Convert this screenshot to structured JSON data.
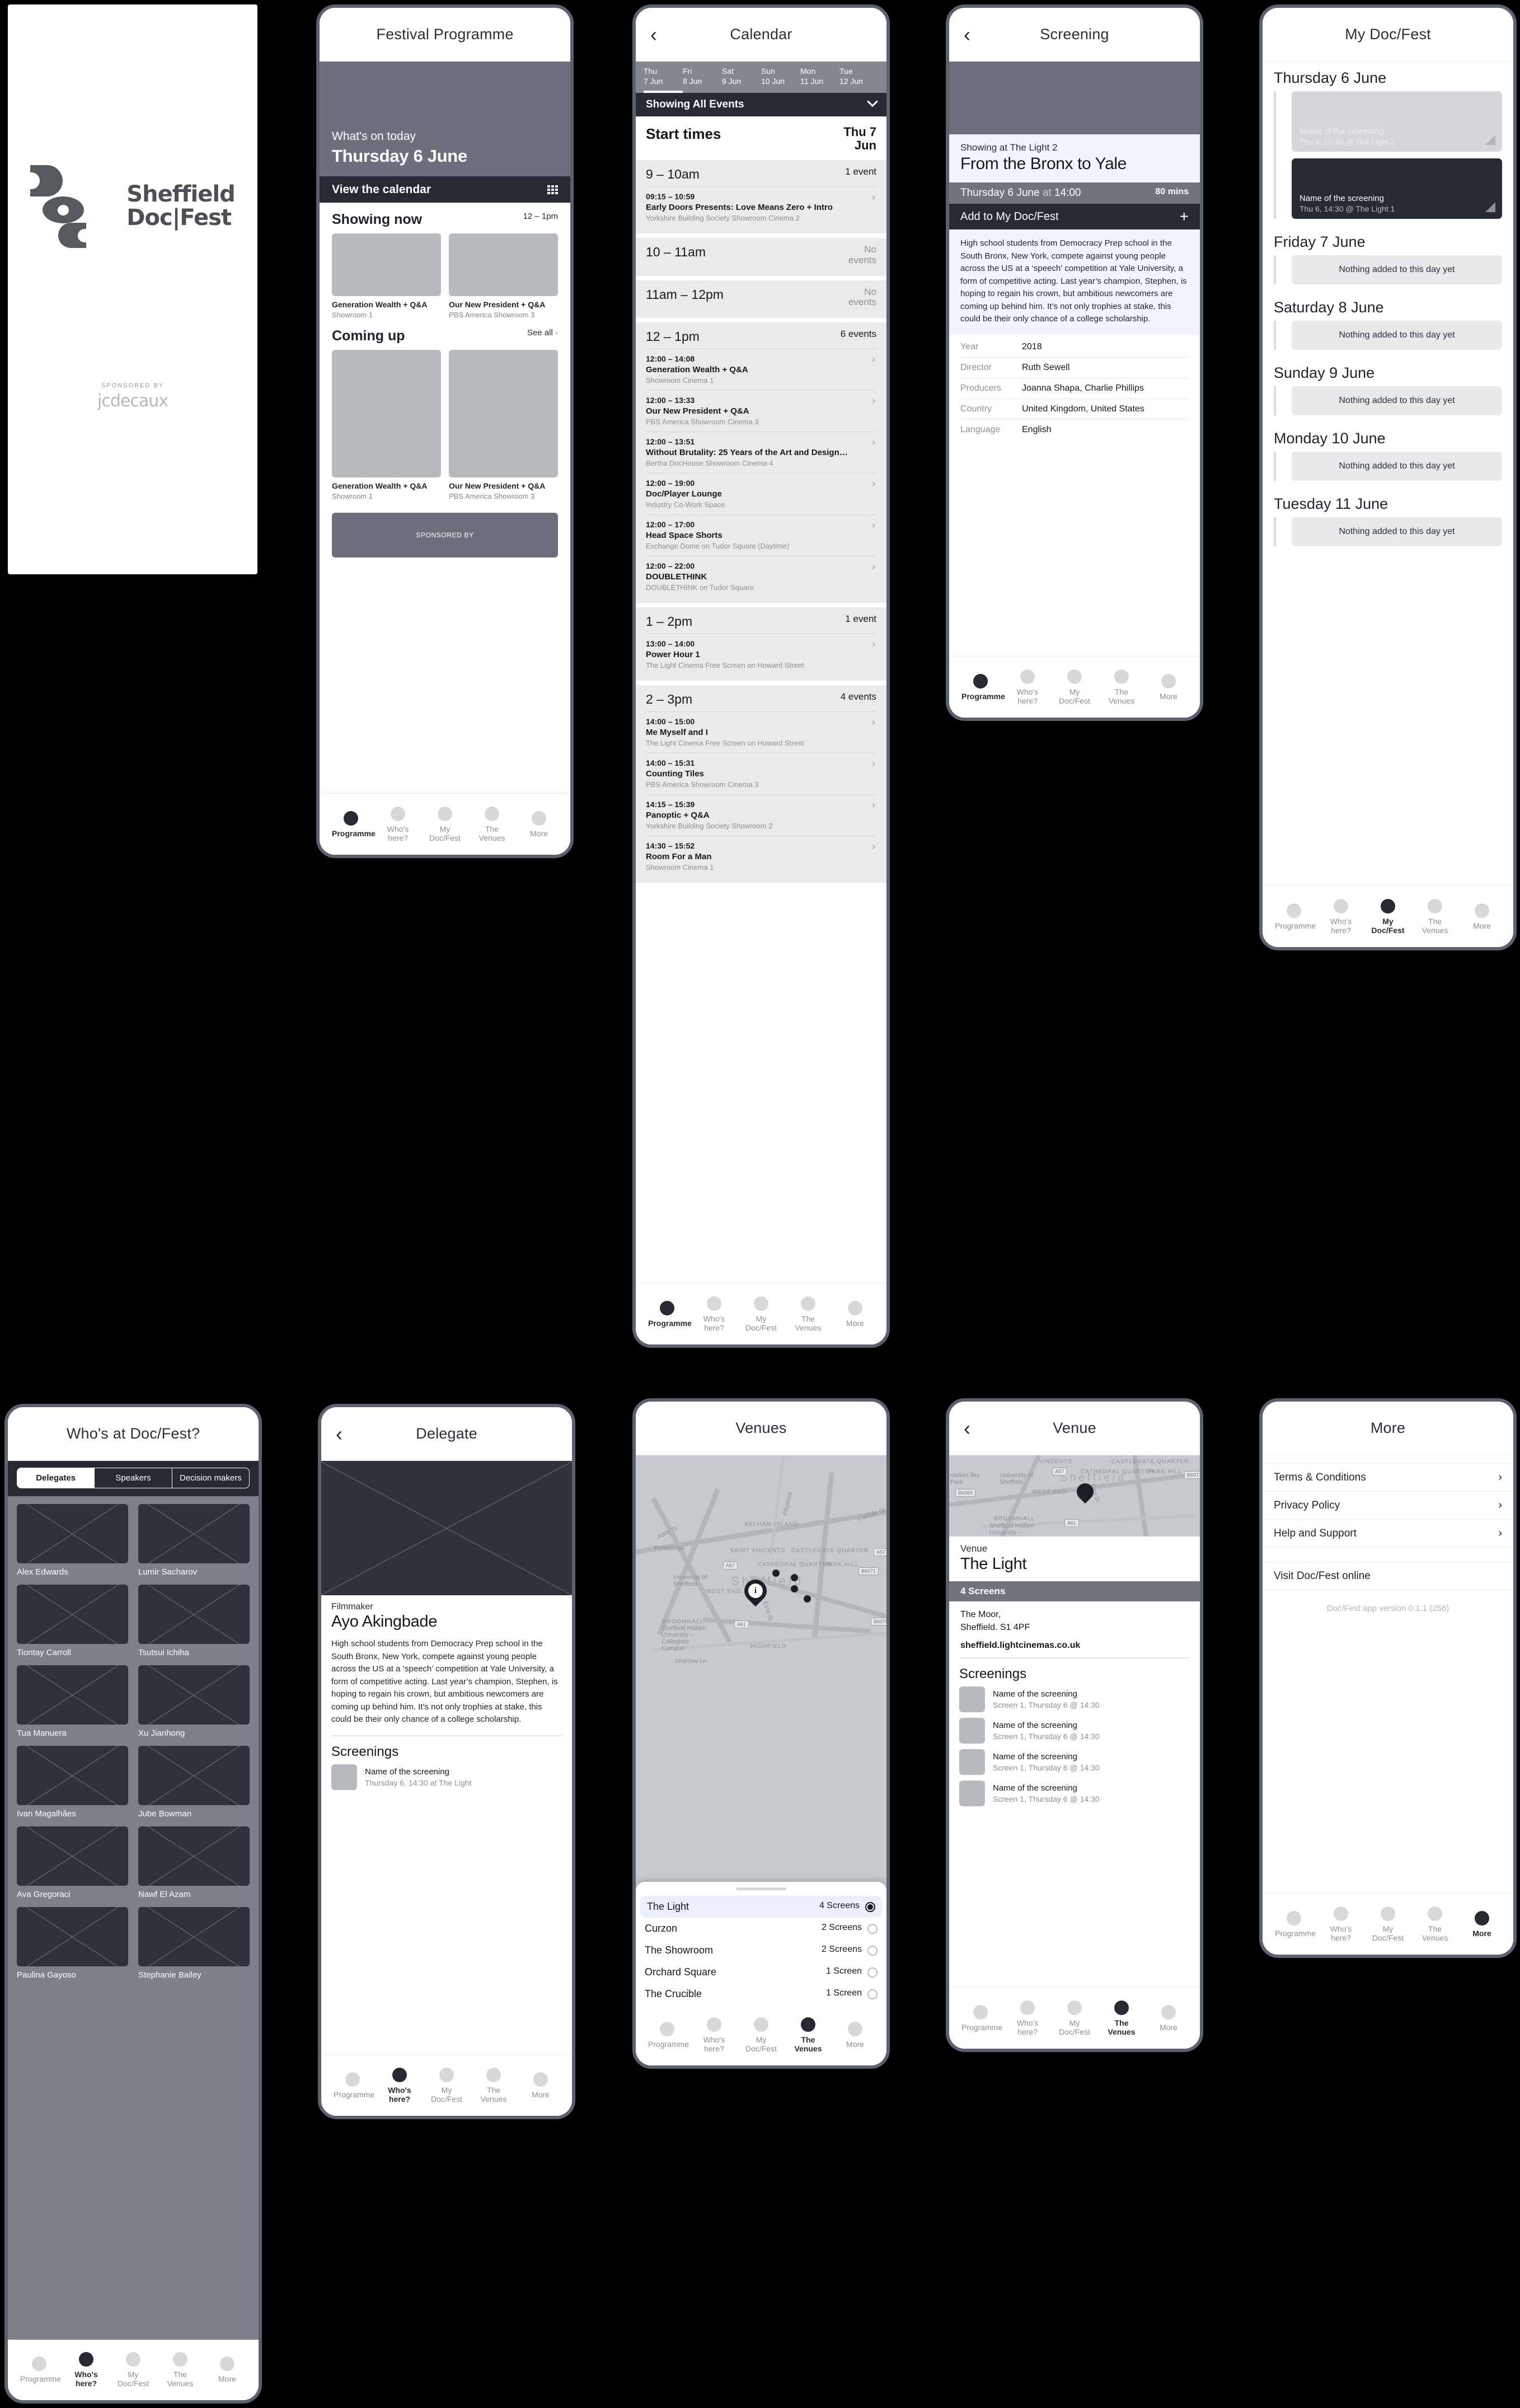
{
  "tabs": [
    {
      "label": "Programme"
    },
    {
      "label": "Who's here?"
    },
    {
      "label": "My Doc/Fest"
    },
    {
      "label": "The Venues"
    },
    {
      "label": "More"
    }
  ],
  "splash": {
    "logo_line1": "Sheffield",
    "logo_line2": "Doc|Fest",
    "sponsored_by": "SPONSORED BY",
    "sponsor_name": "jcdecaux"
  },
  "programme": {
    "title": "Festival Programme",
    "hero_eyebrow": "What's on today",
    "hero_date": "Thursday 6 June",
    "view_calendar": "View the calendar",
    "showing_now_title": "Showing now",
    "showing_now_meta": "12 – 1pm",
    "coming_up_title": "Coming up",
    "see_all": "See all",
    "showing_now": [
      {
        "title": "Generation Wealth + Q&A",
        "venue": "Showroom 1"
      },
      {
        "title": "Our New President + Q&A",
        "venue": "PBS America Showroom 3"
      }
    ],
    "coming_up": [
      {
        "title": "Generation Wealth + Q&A",
        "venue": "Showroom 1"
      },
      {
        "title": "Our New President + Q&A",
        "venue": "PBS America Showroom 3"
      }
    ],
    "sponsor_banner": "SPONSORED BY"
  },
  "calendar": {
    "title": "Calendar",
    "days": [
      {
        "dow": "Thu",
        "date": "7 Jun",
        "selected": true
      },
      {
        "dow": "Fri",
        "date": "8 Jun",
        "selected": false
      },
      {
        "dow": "Sat",
        "date": "9 Jun",
        "selected": false
      },
      {
        "dow": "Sun",
        "date": "10 Jun",
        "selected": false
      },
      {
        "dow": "Mon",
        "date": "11 Jun",
        "selected": false
      },
      {
        "dow": "Tue",
        "date": "12 Jun",
        "selected": false
      }
    ],
    "filter_label": "Showing All Events",
    "start_times_label": "Start times",
    "start_times_date": "Thu 7 Jun",
    "slots": [
      {
        "range": "9 – 10am",
        "count": "1 event",
        "events": [
          {
            "time": "09:15 – 10:59",
            "title": "Early Doors Presents: Love Means Zero + Intro",
            "venue": "Yorkshire Building Society Showroom Cinema 2"
          }
        ]
      },
      {
        "range": "10 – 11am",
        "count": "No events",
        "events": []
      },
      {
        "range": "11am – 12pm",
        "count": "No events",
        "events": []
      },
      {
        "range": "12 – 1pm",
        "count": "6 events",
        "events": [
          {
            "time": "12:00 – 14:08",
            "title": "Generation Wealth + Q&A",
            "venue": "Showroom Cinema 1"
          },
          {
            "time": "12:00 – 13:33",
            "title": "Our New President + Q&A",
            "venue": "PBS America Showroom Cinema 3"
          },
          {
            "time": "12:00 – 13:51",
            "title": "Without Brutality: 25 Years of the Art and Design…",
            "venue": "Bertha DocHouse Showroom Cinema 4"
          },
          {
            "time": "12:00 – 19:00",
            "title": "Doc/Player Lounge",
            "venue": "Industry Co-Work Space"
          },
          {
            "time": "12:00 – 17:00",
            "title": "Head Space Shorts",
            "venue": "Exchange Dome on Tudor Square (Daytime)"
          },
          {
            "time": "12:00 – 22:00",
            "title": "DOUBLETHINK",
            "venue": "DOUBLETHINK on Tudor Square"
          }
        ]
      },
      {
        "range": "1 – 2pm",
        "count": "1 event",
        "events": [
          {
            "time": "13:00 – 14:00",
            "title": "Power Hour 1",
            "venue": "The Light Cinema Free Screen on Howard Street"
          }
        ]
      },
      {
        "range": "2 – 3pm",
        "count": "4 events",
        "events": [
          {
            "time": "14:00 – 15:00",
            "title": "Me Myself and I",
            "venue": "The Light Cinema Free Screen on Howard Street"
          },
          {
            "time": "14:00 – 15:31",
            "title": "Counting Tiles",
            "venue": "PBS America Showroom Cinema 3"
          },
          {
            "time": "14:15 – 15:39",
            "title": "Panoptic + Q&A",
            "venue": "Yorkshire Building Society Showroom 2"
          },
          {
            "time": "14:30 – 15:52",
            "title": "Room For a Man",
            "venue": "Showroom Cinema 1"
          }
        ]
      }
    ]
  },
  "screening": {
    "title": "Screening",
    "eyebrow": "Showing at The Light 2",
    "name": "From the Bronx to Yale",
    "when_date": "Thursday 6 June",
    "when_at": "at",
    "when_time": "14:00",
    "duration": "80 mins",
    "add_label": "Add to My Doc/Fest",
    "synopsis": "High school students from Democracy Prep school in the South Bronx, New York, compete against young people across the US at a ‘speech’ competition at Yale University, a form of competitive acting. Last year’s champion, Stephen, is hoping to regain his crown, but ambitious newcomers are coming up behind him. It’s not only trophies at stake, this could be their only chance of a college scholarship.",
    "meta": [
      {
        "key": "Year",
        "value": "2018"
      },
      {
        "key": "Director",
        "value": "Ruth Sewell"
      },
      {
        "key": "Producers",
        "value": "Joanna Shapa, Charlie Phillips"
      },
      {
        "key": "Country",
        "value": "United Kingdom, United States"
      },
      {
        "key": "Language",
        "value": "English"
      }
    ]
  },
  "mydocfest": {
    "title": "My Doc/Fest",
    "empty_text": "Nothing added to this day yet",
    "days": [
      {
        "date": "Thursday 6 June",
        "items": [
          {
            "name": "Name of the screening",
            "sub": "Thu 6, 10:30 @ The Light 2",
            "style": "light"
          },
          {
            "name": "Name of the screening",
            "sub": "Thu 6, 14:30 @ The Light 1",
            "style": "dark"
          }
        ]
      },
      {
        "date": "Friday 7 June",
        "items": []
      },
      {
        "date": "Saturday 8 June",
        "items": []
      },
      {
        "date": "Sunday 9 June",
        "items": []
      },
      {
        "date": "Monday 10 June",
        "items": []
      },
      {
        "date": "Tuesday 11 June",
        "items": []
      }
    ]
  },
  "whoshere": {
    "title": "Who's at Doc/Fest?",
    "segments": [
      {
        "label": "Delegates",
        "selected": true
      },
      {
        "label": "Speakers",
        "selected": false
      },
      {
        "label": "Decision makers",
        "selected": false
      }
    ],
    "people": [
      {
        "name": "Alex Edwards"
      },
      {
        "name": "Lumir Sacharov"
      },
      {
        "name": "Tiontay Carroll"
      },
      {
        "name": "Tsutsui Ichiha"
      },
      {
        "name": "Tua Manuera"
      },
      {
        "name": "Xu Jianhong"
      },
      {
        "name": "Ivan Magalhães"
      },
      {
        "name": "Jube Bowman"
      },
      {
        "name": "Ava Gregoraci"
      },
      {
        "name": "Nawf El Azam"
      },
      {
        "name": "Paulina Gayoso"
      },
      {
        "name": "Stephanie Bailey"
      }
    ]
  },
  "delegate": {
    "title": "Delegate",
    "role": "Filmmaker",
    "name": "Ayo Akingbade",
    "bio": "High school students from Democracy Prep school in the South Bronx, New York, compete against young people across the US at a ‘speech’ competition at Yale University, a form of competitive acting. Last year’s champion, Stephen, is hoping to regain his crown, but ambitious newcomers are coming up behind him. It’s not only trophies at stake, this could be their only chance of a college scholarship.",
    "screenings_title": "Screenings",
    "screenings": [
      {
        "name": "Name of the screening",
        "sub": "Thursday 6, 14:30 at The Light"
      }
    ]
  },
  "venues": {
    "title": "Venues",
    "map_labels": [
      "KELHAM ISLAND",
      "SAINT VINCENTS",
      "CASTLEGATE QUARTER",
      "CATHEDRAL QUARTER",
      "PARK HILL",
      "WEST END",
      "BROOMHALL",
      "HIGHFIELD",
      "Ponderosa",
      "University of Sheffield",
      "Sheffield Hallam University – Collegiate Campus",
      "Addy St",
      "Carlisle St",
      "Eyre St",
      "Sharrow Ln",
      "Pitsmoor"
    ],
    "map_city": "Sheffield",
    "map_shields": [
      "A57",
      "A57",
      "A61",
      "B6071",
      "B6070"
    ],
    "pin_label": "i",
    "list": [
      {
        "name": "The Light",
        "screens": "4 Screens",
        "selected": true
      },
      {
        "name": "Curzon",
        "screens": "2 Screens",
        "selected": false
      },
      {
        "name": "The Showroom",
        "screens": "2 Screens",
        "selected": false
      },
      {
        "name": "Orchard Square",
        "screens": "1 Screen",
        "selected": false
      },
      {
        "name": "The Crucible",
        "screens": "1 Screen",
        "selected": false
      }
    ]
  },
  "venue_detail": {
    "title": "Venue",
    "eyebrow": "Venue",
    "name": "The Light",
    "screens": "4 Screens",
    "address": "The Moor,\nSheffield. S1 4PF",
    "website": "sheffield.lightcinemas.co.uk",
    "screenings_title": "Screenings",
    "map_labels": [
      "VINCENTS",
      "CASTLEGATE QUARTER",
      "CATHEDRAL QUARTER",
      "PARK HILL",
      "WEST END",
      "BROOMHALL",
      "University of Sheffield",
      "Sheffield Hallam University –",
      "Eyre St",
      "rookes lley Park"
    ],
    "map_city": "Sheffield",
    "map_shields": [
      "A57",
      "A61",
      "B6071",
      "B6069"
    ],
    "screenings": [
      {
        "name": "Name of the screening",
        "sub": "Screen 1, Thursday 6 @ 14:30"
      },
      {
        "name": "Name of the screening",
        "sub": "Screen 1, Thursday 6 @ 14:30"
      },
      {
        "name": "Name of the screening",
        "sub": "Screen 1, Thursday 6 @ 14:30"
      },
      {
        "name": "Name of the screening",
        "sub": "Screen 1, Thursday 6 @ 14:30"
      }
    ]
  },
  "more": {
    "title": "More",
    "rows": [
      {
        "label": "Terms & Conditions",
        "chevron": true
      },
      {
        "label": "Privacy Policy",
        "chevron": true
      },
      {
        "label": "Help and Support",
        "chevron": true
      }
    ],
    "visit": "Visit Doc/Fest online",
    "version": "Doc/Fest app version 0.1.1 (256)"
  }
}
